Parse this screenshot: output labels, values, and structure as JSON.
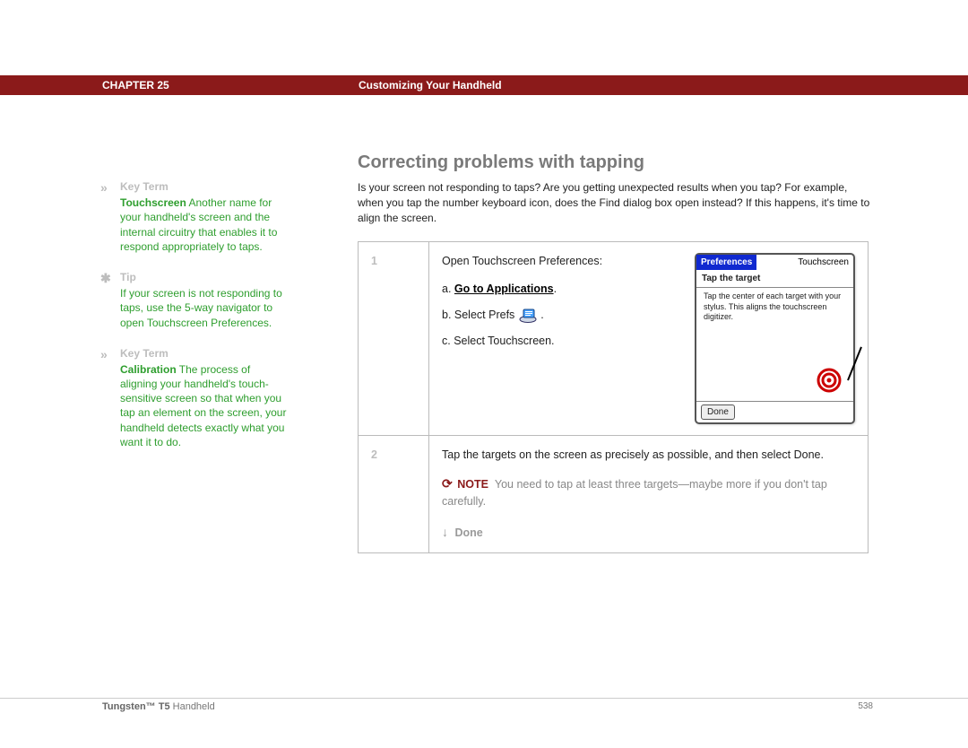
{
  "header": {
    "chapter": "CHAPTER 25",
    "title": "Customizing Your Handheld"
  },
  "sidebar": {
    "items": [
      {
        "icon": "»",
        "label": "Key Term",
        "term": "Touchscreen",
        "text": "Another name for your handheld's screen and the internal circuitry that enables it to respond appropriately to taps."
      },
      {
        "icon": "✱",
        "label": "Tip",
        "term": "",
        "text": "If your screen is not responding to taps, use the 5-way navigator to open Touchscreen Preferences."
      },
      {
        "icon": "»",
        "label": "Key Term",
        "term": "Calibration",
        "text": "The process of aligning your handheld's touch-sensitive screen so that when you tap an element on the screen, your handheld detects exactly what you want it to do."
      }
    ]
  },
  "section": {
    "title": "Correcting problems with tapping",
    "intro": "Is your screen not responding to taps? Are you getting unexpected results when you tap? For example, when you tap the number keyboard icon, does the Find dialog box open instead? If this happens, it's time to align the screen."
  },
  "steps": {
    "1": {
      "num": "1",
      "lead": "Open Touchscreen Preferences:",
      "a_prefix": "a.",
      "a_link": "Go to Applications",
      "a_suffix": ".",
      "b": "b.  Select Prefs ",
      "b_suffix": ".",
      "c": "c.  Select Touchscreen."
    },
    "2": {
      "num": "2",
      "text": "Tap the targets on the screen as precisely as possible, and then select Done.",
      "note_label": "NOTE",
      "note_text": "You need to tap at least three targets—maybe more if you don't tap carefully.",
      "done": "Done"
    }
  },
  "device": {
    "title_left": "Preferences",
    "title_right": "Touchscreen",
    "subtitle": "Tap the target",
    "body": "Tap the center of each target with your stylus. This aligns the touchscreen digitizer.",
    "button": "Done"
  },
  "footer": {
    "product_bold": "Tungsten™ T5",
    "product_rest": " Handheld",
    "page": "538"
  }
}
